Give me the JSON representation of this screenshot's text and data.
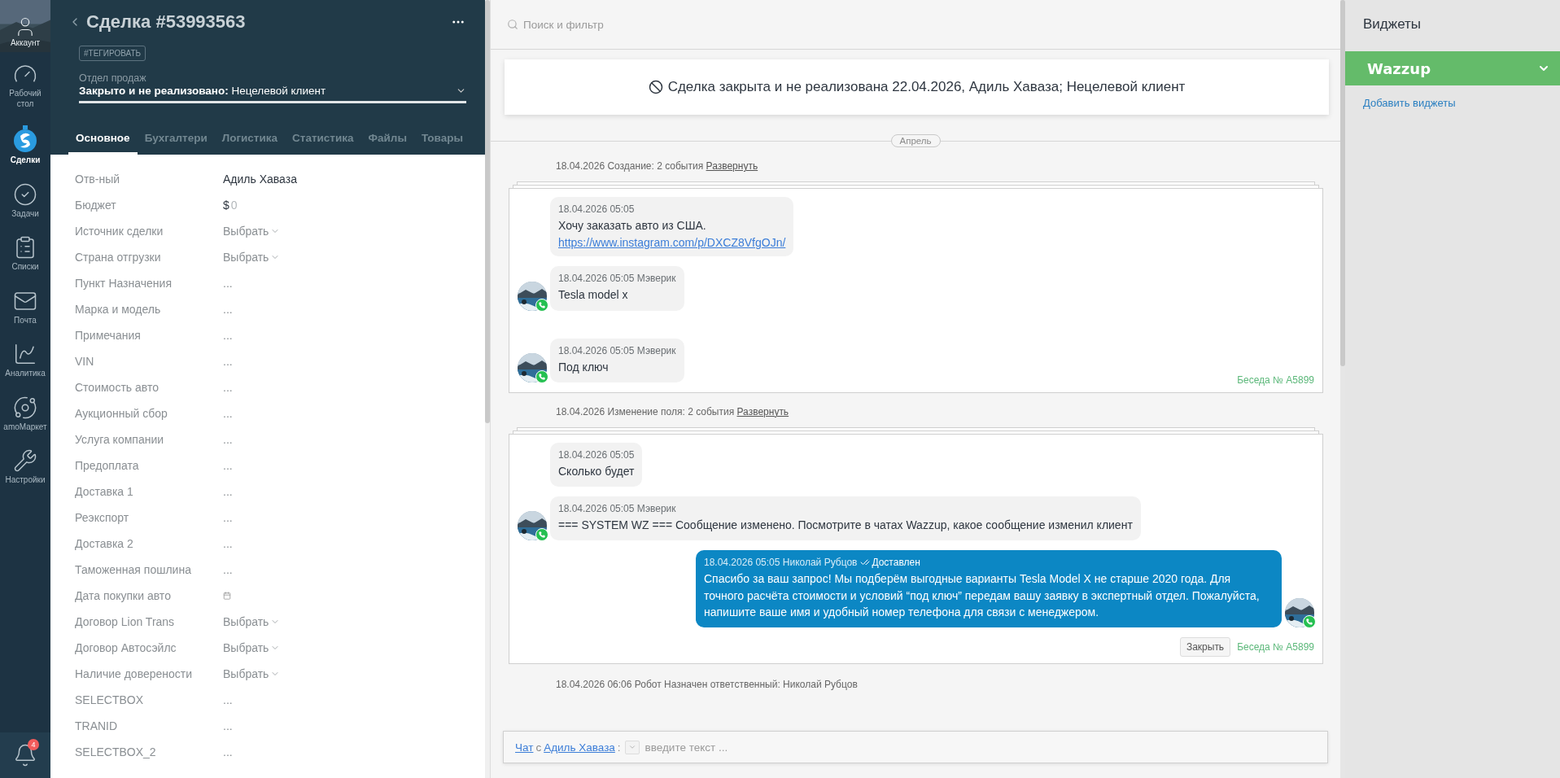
{
  "nav": {
    "account": {
      "label": "Аккаунт"
    },
    "items": [
      {
        "label": "Рабочий стол",
        "selected": false
      },
      {
        "label": "Сделки",
        "selected": true
      },
      {
        "label": "Задачи",
        "selected": false
      },
      {
        "label": "Списки",
        "selected": false
      },
      {
        "label": "Почта",
        "selected": false
      },
      {
        "label": "Аналитика",
        "selected": false
      },
      {
        "label": "amoМаркет",
        "selected": false
      },
      {
        "label": "Настройки",
        "selected": false
      }
    ],
    "notifications": {
      "badge": "4"
    }
  },
  "deal": {
    "title": "Сделка #53993563",
    "tag_button": "#ТЕГИРОВАТЬ",
    "pipeline": "Отдел продаж",
    "status": {
      "stage": "Закрыто и не реализовано:",
      "reason": "Нецелевой клиент"
    },
    "tabs": [
      {
        "label": "Основное",
        "selected": true
      },
      {
        "label": "Бухгалтери",
        "selected": false
      },
      {
        "label": "Логистика",
        "selected": false
      },
      {
        "label": "Статистика",
        "selected": false
      },
      {
        "label": "Файлы",
        "selected": false
      },
      {
        "label": "Товары",
        "selected": false
      }
    ],
    "fields": [
      {
        "label": "Отв-ный",
        "kind": "text",
        "value": "Адиль Хаваза"
      },
      {
        "label": "Бюджет",
        "kind": "money",
        "currency": "$",
        "value": "0"
      },
      {
        "label": "Источник сделки",
        "kind": "select",
        "value": "Выбрать"
      },
      {
        "label": "Страна отгрузки",
        "kind": "select",
        "value": "Выбрать"
      },
      {
        "label": "Пункт Назначения",
        "kind": "empty",
        "value": "..."
      },
      {
        "label": "Марка и модель",
        "kind": "empty",
        "value": "..."
      },
      {
        "label": "Примечания",
        "kind": "empty",
        "value": "..."
      },
      {
        "label": "VIN",
        "kind": "empty",
        "value": "..."
      },
      {
        "label": "Стоимость авто",
        "kind": "empty",
        "value": "..."
      },
      {
        "label": "Аукционный сбор",
        "kind": "empty",
        "value": "..."
      },
      {
        "label": "Услуга компании",
        "kind": "empty",
        "value": "..."
      },
      {
        "label": "Предоплата",
        "kind": "empty",
        "value": "..."
      },
      {
        "label": "Доставка 1",
        "kind": "empty",
        "value": "..."
      },
      {
        "label": "Реэкспорт",
        "kind": "empty",
        "value": "..."
      },
      {
        "label": "Доставка 2",
        "kind": "empty",
        "value": "..."
      },
      {
        "label": "Таможенная пошлина",
        "kind": "empty",
        "value": "..."
      },
      {
        "label": "Дата покупки авто",
        "kind": "date"
      },
      {
        "label": "Договор Lion Trans",
        "kind": "select",
        "value": "Выбрать"
      },
      {
        "label": "Договор Автосэйлс",
        "kind": "select",
        "value": "Выбрать"
      },
      {
        "label": "Наличие доверености",
        "kind": "select",
        "value": "Выбрать"
      },
      {
        "label": "SELECTBOX",
        "kind": "empty",
        "value": "..."
      },
      {
        "label": "TRANID",
        "kind": "empty",
        "value": "..."
      },
      {
        "label": "SELECTBOX_2",
        "kind": "empty",
        "value": "..."
      }
    ]
  },
  "feed": {
    "search": {
      "placeholder": "Поиск и фильтр"
    },
    "banner": "Сделка закрыта и не реализована 22.04.2026, Адиль Хаваза; Нецелевой клиент",
    "month": "Апрель",
    "groups": [
      {
        "header": "18.04.2026 Создание: 2 события",
        "expand": "Развернуть",
        "conversation": "Беседа № A5899",
        "messages": [
          {
            "kind": "incoming",
            "avatar": false,
            "meta": "18.04.2026 05:05",
            "text": "Хочу заказать авто из США.",
            "link": "https://www.instagram.com/p/DXCZ8VfgOJn/"
          },
          {
            "kind": "incoming",
            "avatar": true,
            "meta": "18.04.2026 05:05 Мэверик",
            "text": "Tesla model x"
          },
          {
            "kind": "incoming",
            "avatar": true,
            "meta": "18.04.2026 05:05 Мэверик",
            "text": "Под ключ"
          }
        ]
      },
      {
        "header": "18.04.2026 Изменение поля: 2 события",
        "expand": "Развернуть",
        "conversation": "Беседа № A5899",
        "close_button": "Закрыть",
        "messages": [
          {
            "kind": "incoming",
            "avatar": false,
            "meta": "18.04.2026 05:05",
            "text": "Сколько будет"
          },
          {
            "kind": "incoming",
            "avatar": true,
            "meta": "18.04.2026 05:05 Мэверик",
            "text": "=== SYSTEM WZ === Сообщение изменено. Посмотрите в чатах Wazzup, какое сообщение изменил клиент"
          },
          {
            "kind": "outgoing",
            "avatar": true,
            "meta": "18.04.2026 05:05 Николай Рубцов",
            "status": "Доставлен",
            "text": "Спасибо за ваш запрос! Мы подберём выгодные варианты Tesla Model X не старше 2020 года. Для точного расчёта стоимости и условий “под ключ” передам вашу заявку в экспертный отдел. Пожалуйста, напишите ваше имя и удобный номер телефона для связи с менеджером."
          }
        ]
      }
    ],
    "robot_line": "18.04.2026 06:06 Робот Назначен ответственный: Николай Рубцов",
    "composer": {
      "chat_link": "Чат",
      "with": "с",
      "contact": "Адиль Хаваза",
      "colon": ":",
      "placeholder": "введите текст ..."
    }
  },
  "widgets": {
    "title": "Виджеты",
    "items": [
      {
        "name": "Wazzup",
        "expanded": false
      }
    ],
    "add_link": "Добавить виджеты"
  }
}
